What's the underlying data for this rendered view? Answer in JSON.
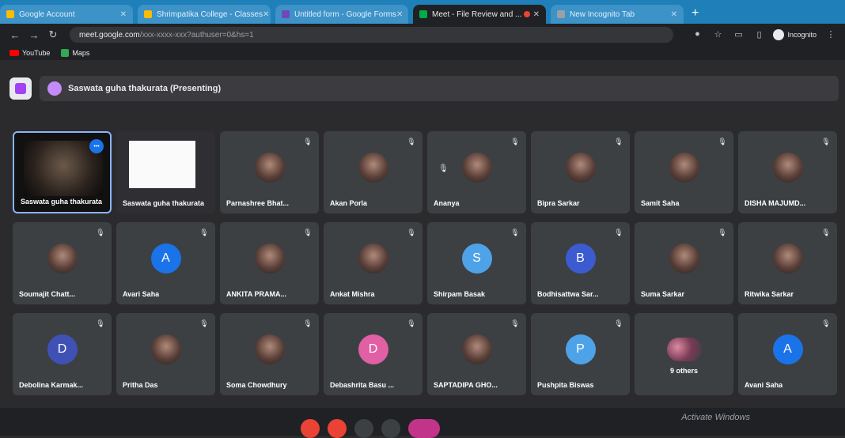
{
  "tabs": [
    {
      "title": "Google Account",
      "active": false
    },
    {
      "title": "Shrimpatika College - Classes",
      "active": false
    },
    {
      "title": "Untitled form - Google Forms",
      "active": false
    },
    {
      "title": "Meet - File Review and ...",
      "active": true,
      "recording": true
    },
    {
      "title": "New Incognito Tab",
      "active": false
    }
  ],
  "toolbar": {
    "url_host": "meet.google.com",
    "url_path": "/xxx-xxxx-xxx?authuser=0&hs=1",
    "profile_label": "Incognito"
  },
  "bookmarks": [
    {
      "label": "YouTube",
      "icon": "youtube-icon"
    },
    {
      "label": "Maps",
      "icon": "maps-icon"
    }
  ],
  "presenter": {
    "label": "Saswata guha thakurata (Presenting)"
  },
  "participants": [
    {
      "name": "Saswata guha thakurata",
      "type": "video"
    },
    {
      "name": "Saswata guha thakurata",
      "type": "screen"
    },
    {
      "name": "Parnashree Bhat...",
      "type": "photo"
    },
    {
      "name": "Akan Porla",
      "type": "photo"
    },
    {
      "name": "Ananya",
      "type": "photo"
    },
    {
      "name": "Bipra Sarkar",
      "type": "photo"
    },
    {
      "name": "Samit Saha",
      "type": "photo"
    },
    {
      "name": "DISHA MAJUMD...",
      "type": "photo"
    },
    {
      "name": "Soumajit Chatt...",
      "type": "photo"
    },
    {
      "name": "Avari Saha",
      "type": "letter",
      "letter": "A",
      "color": "#1a73e8"
    },
    {
      "name": "ANKITA PRAMA...",
      "type": "photo"
    },
    {
      "name": "Ankat Mishra",
      "type": "photo"
    },
    {
      "name": "Shirpam Basak",
      "type": "letter",
      "letter": "S",
      "color": "#4ea3e8"
    },
    {
      "name": "Bodhisattwa Sar...",
      "type": "letter",
      "letter": "B",
      "color": "#3c5bd0"
    },
    {
      "name": "Suma Sarkar",
      "type": "photo"
    },
    {
      "name": "Ritwika Sarkar",
      "type": "photo"
    },
    {
      "name": "Debolina Karmak...",
      "type": "letter",
      "letter": "D",
      "color": "#3f51b5"
    },
    {
      "name": "Pritha Das",
      "type": "photo"
    },
    {
      "name": "Soma Chowdhury",
      "type": "photo"
    },
    {
      "name": "Debashrita Basu ...",
      "type": "letter",
      "letter": "D",
      "color": "#e05fa5"
    },
    {
      "name": "SAPTADIPA GHO...",
      "type": "photo"
    },
    {
      "name": "Pushpita Biswas",
      "type": "letter",
      "letter": "P",
      "color": "#4ea3e8"
    },
    {
      "name": "9 others",
      "type": "others"
    },
    {
      "name": "Avani Saha",
      "type": "letter",
      "letter": "A",
      "color": "#1a73e8"
    }
  ],
  "taskbar": {
    "activate_text": "Activate Windows"
  },
  "colors": {
    "tab_strip": "#1f7fb8",
    "meet_bg": "#2b2b2e",
    "tile_bg": "#3c4043",
    "active_speaker": "#8ab4f8"
  }
}
